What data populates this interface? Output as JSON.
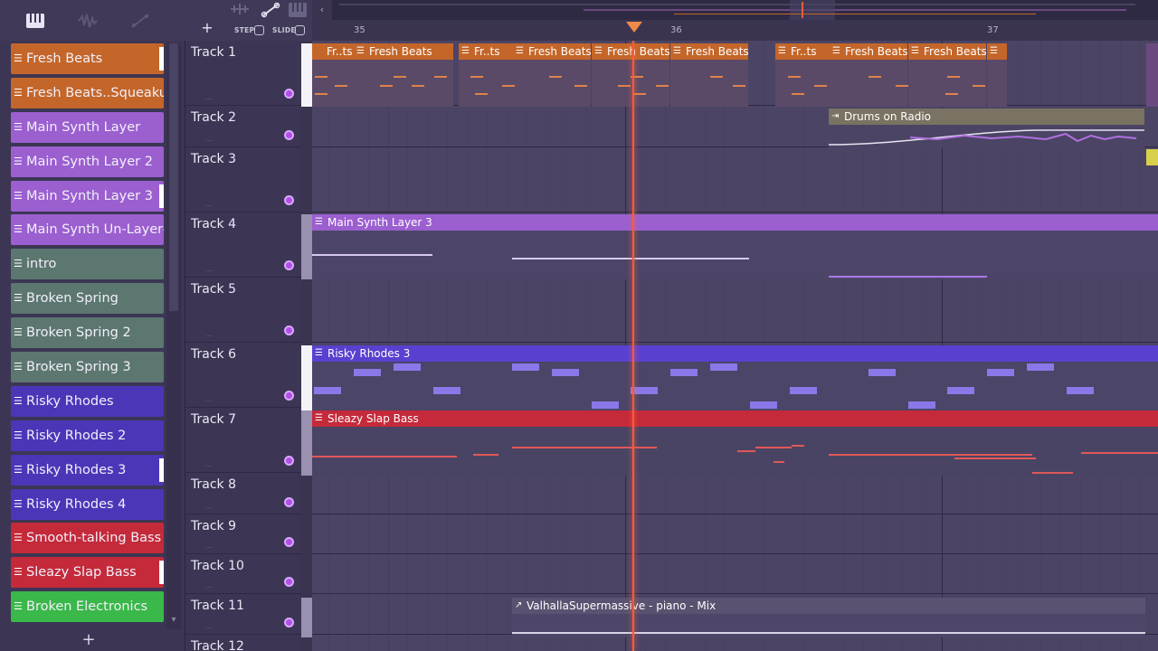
{
  "picker": {
    "add_label": "+",
    "patterns": [
      {
        "label": "Fresh Beats",
        "color": "#c4662a",
        "selected": true
      },
      {
        "label": "Fresh Beats..Squeakuel",
        "color": "#c4662a",
        "selected": false
      },
      {
        "label": "Main Synth Layer",
        "color": "#9b5fd0",
        "selected": false
      },
      {
        "label": "Main Synth Layer 2",
        "color": "#9b5fd0",
        "selected": false
      },
      {
        "label": "Main Synth Layer 3",
        "color": "#9b5fd0",
        "selected": true
      },
      {
        "label": "Main Synth Un-Layered",
        "color": "#9b5fd0",
        "selected": false
      },
      {
        "label": "intro",
        "color": "#5c7670",
        "selected": false
      },
      {
        "label": "Broken Spring",
        "color": "#5c7670",
        "selected": false
      },
      {
        "label": "Broken Spring 2",
        "color": "#5c7670",
        "selected": false
      },
      {
        "label": "Broken Spring 3",
        "color": "#5c7670",
        "selected": false
      },
      {
        "label": "Risky Rhodes",
        "color": "#4c36b8",
        "selected": false
      },
      {
        "label": "Risky Rhodes 2",
        "color": "#4c36b8",
        "selected": false
      },
      {
        "label": "Risky Rhodes 3",
        "color": "#4c36b8",
        "selected": true
      },
      {
        "label": "Risky Rhodes 4",
        "color": "#4c36b8",
        "selected": false
      },
      {
        "label": "Smooth-talking Bass",
        "color": "#c42a3a",
        "selected": false
      },
      {
        "label": "Sleazy Slap Bass",
        "color": "#c42a3a",
        "selected": true
      },
      {
        "label": "Broken Electronics",
        "color": "#3ab84a",
        "selected": false
      }
    ]
  },
  "toolbar": {
    "add": "+",
    "step_label": "STEP",
    "slide_label": "SLIDE"
  },
  "ruler": {
    "bars": [
      "35",
      "36",
      "37"
    ]
  },
  "tracks": [
    {
      "name": "Track 1"
    },
    {
      "name": "Track 2"
    },
    {
      "name": "Track 3"
    },
    {
      "name": "Track 4"
    },
    {
      "name": "Track 5"
    },
    {
      "name": "Track 6"
    },
    {
      "name": "Track 7"
    },
    {
      "name": "Track 8"
    },
    {
      "name": "Track 9"
    },
    {
      "name": "Track 10"
    },
    {
      "name": "Track 11"
    },
    {
      "name": "Track 12"
    }
  ],
  "clips": {
    "fresh_beats_short": "Fr..ts",
    "fresh_beats": "Fresh Beats",
    "drums_on_radio": "Drums on Radio",
    "main_synth_layer_3": "Main Synth Layer 3",
    "risky_rhodes_3": "Risky Rhodes 3",
    "sleazy_slap_bass": "Sleazy Slap Bass",
    "valhalla": "ValhallaSupermassive - piano - Mix"
  },
  "colors": {
    "orange": "#c4662a",
    "purple": "#9b5fd0",
    "indigo": "#4c36b8",
    "red": "#c42a3a",
    "green": "#3ab84a",
    "playhead": "#ff5a3a"
  }
}
